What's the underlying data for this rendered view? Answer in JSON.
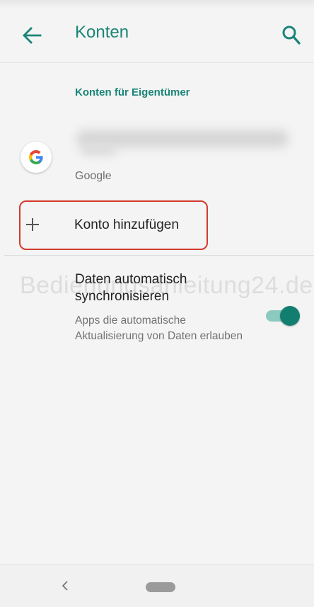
{
  "appbar": {
    "title": "Konten"
  },
  "section": {
    "header": "Konten für Eigentümer"
  },
  "account": {
    "type": "Google"
  },
  "add_account": {
    "label": "Konto hinzufügen"
  },
  "sync": {
    "title": "Daten automatisch synchronisieren",
    "description": "Apps die automatische Aktualisierung von Daten erlauben",
    "enabled": true
  },
  "watermark": {
    "text": "Bedienungsanleitung24.de"
  },
  "icons": {
    "back": "arrow-left-icon",
    "search": "search-icon",
    "account": "google-logo-icon",
    "add": "plus-icon",
    "nav_back": "chevron-left-icon"
  },
  "colors": {
    "accent": "#1a8577",
    "toggle_on": "#127e6f",
    "highlight": "#d33a2c"
  }
}
